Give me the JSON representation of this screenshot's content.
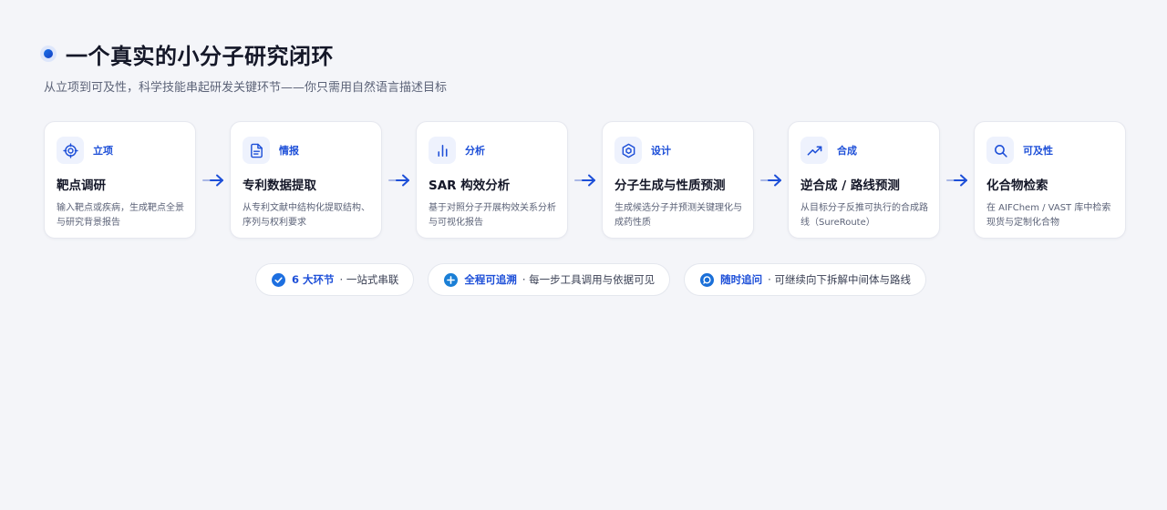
{
  "header": {
    "title": "一个真实的小分子研究闭环",
    "subtitle": "从立项到可及性，科学技能串起研发关键环节——你只需用自然语言描述目标"
  },
  "colors": {
    "accent": "#1d4fd8",
    "icon_bg": "#eef2fd",
    "background": "#f4f5f9"
  },
  "stages": [
    {
      "icon": "target-icon",
      "label": "立项",
      "title": "靶点调研",
      "desc": "输入靶点或疾病，生成靶点全景与研究背景报告"
    },
    {
      "icon": "document-icon",
      "label": "情报",
      "title": "专利数据提取",
      "desc": "从专利文献中结构化提取结构、序列与权利要求"
    },
    {
      "icon": "bar-chart-icon",
      "label": "分析",
      "title": "SAR 构效分析",
      "desc": "基于对照分子开展构效关系分析与可视化报告"
    },
    {
      "icon": "hexagon-molecule-icon",
      "label": "设计",
      "title": "分子生成与性质预测",
      "desc": "生成候选分子并预测关键理化与成药性质"
    },
    {
      "icon": "trending-up-icon",
      "label": "合成",
      "title": "逆合成 / 路线预测",
      "desc": "从目标分子反推可执行的合成路线（SureRoute）"
    },
    {
      "icon": "search-icon",
      "label": "可及性",
      "title": "化合物检索",
      "desc": "在 AIFChem / VAST 库中检索现货与定制化合物"
    }
  ],
  "badges": [
    {
      "icon": "check-circle-icon",
      "strong": "6 大环节",
      "rest": "· 一站式串联"
    },
    {
      "icon": "plus-circle-icon",
      "strong": "全程可追溯",
      "rest": "· 每一步工具调用与依据可见"
    },
    {
      "icon": "chat-bubble-icon",
      "strong": "随时追问",
      "rest": "· 可继续向下拆解中间体与路线"
    }
  ]
}
